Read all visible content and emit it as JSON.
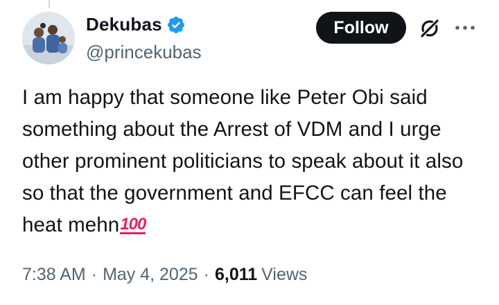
{
  "author": {
    "display_name": "Dekubas",
    "handle": "@princekubas",
    "verified": true
  },
  "actions": {
    "follow_label": "Follow",
    "grok_icon": "grok-icon",
    "more_icon": "more-icon"
  },
  "tweet": {
    "text": "I am happy that someone like Peter Obi said something about the Arrest of VDM and I urge other prominent politicians to speak about it also so that the government and EFCC can feel the heat mehn",
    "emoji": "100"
  },
  "meta": {
    "time": "7:38 AM",
    "date": "May 4, 2025",
    "separator": "·",
    "views_count": "6,011",
    "views_label": "Views"
  },
  "colors": {
    "text": "#0f1419",
    "secondary": "#536471",
    "verified_blue": "#1d9bf0",
    "follow_bg": "#0f1419",
    "emoji_red": "#e0245e"
  }
}
